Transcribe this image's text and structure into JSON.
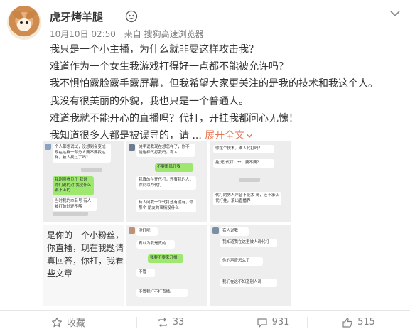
{
  "post": {
    "username": "虎牙烤羊腿",
    "date": "10月10日 02:50",
    "source": "来自 搜狗高速浏览器",
    "lines": [
      "我只是一个小主播，为什么就非要这样攻击我？",
      "难道作为一个女生我游戏打得好一点都不能被允许吗？",
      "我不惧怕露脸露手露屏幕，但我希望大家更关注的是我的技术和我这个人。",
      "我没有很美丽的外貌，我也只是一个普通人。",
      "难道我就不能开心的直播吗？代打，开挂我都问心无愧！"
    ],
    "last_line": "我知道很多人都是被误导的，请 ...",
    "expand_label": "展开全文",
    "expand_icon": "chevron-down-icon"
  },
  "images": {
    "t1": {
      "a": "个人都想试试，没想到会变成现在这样一部分人要不要找这样，被人找过了吗？",
      "b": "我刚刚看见了 我说 你们说的对 我没什么说不上的",
      "c": "当时我的本名号 有人被打破过还不够"
    },
    "t2": {
      "a": "摊手说我现在想怎样了，你不能这样代打我吗。有人",
      "b": "不要跟风开我",
      "c": "我真的在开代打，还有我的人，你别以为代打",
      "d": "有人问我一个代打还有没有，你那个 朋友的事情没什么"
    },
    "t3": {
      "a": "你这个技术，谁人代打吗？",
      "b": "挂 还 代打，**，要不要？",
      "c": "代打的男人声音不能太 哥，还不承认 代打挂，滚出直播界"
    },
    "t4": {
      "text": "是你的一个小粉丝，欢看你直播，现在我题请你认真回答，你打，我看到一些文章"
    },
    "t5": {
      "a": "没好吧",
      "b": "真以为我是真的",
      "c": "我要不要来开播",
      "d": "不管",
      "e": "不管我打不打直播。"
    },
    "t6": {
      "a": "有人说我",
      "b": "我知道我在这里被人说代打",
      "c": "你的声音怎么了",
      "d": "我们在这不知道别人说"
    }
  },
  "actions": {
    "favorite": "收藏",
    "repost": "33",
    "comment": "931",
    "like": "515"
  },
  "colors": {
    "accent": "#eb7350",
    "meta": "#808080",
    "bubble_green": "#9fe870"
  }
}
